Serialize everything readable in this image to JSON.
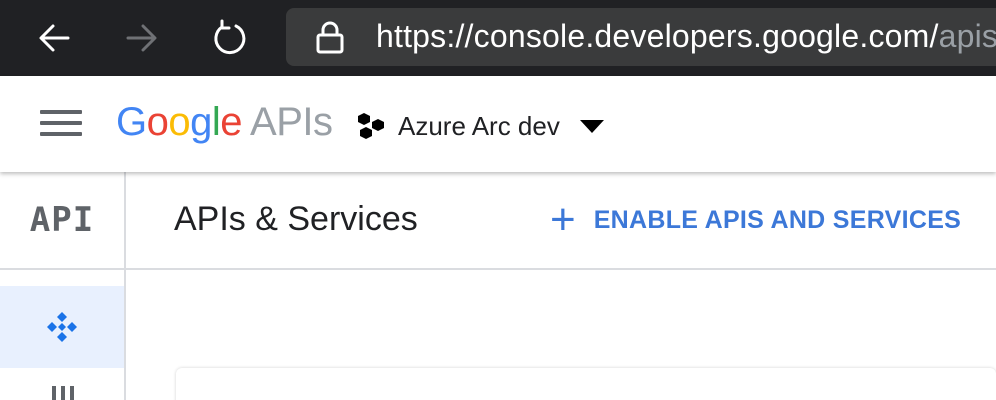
{
  "browser": {
    "url_main": "https://console.developers.google.com/",
    "url_path": "apis/",
    "icons": [
      "back-icon",
      "forward-icon",
      "reload-icon",
      "lock-icon"
    ]
  },
  "header": {
    "logo_letters": [
      "G",
      "o",
      "o",
      "g",
      "l",
      "e"
    ],
    "logo_suffix": "APIs",
    "project_name": "Azure Arc dev",
    "brand_colors": {
      "blue": "#4285f4",
      "red": "#ea4335",
      "yellow": "#fbbc05",
      "green": "#34a853"
    }
  },
  "rail": {
    "api_label": "API",
    "active_color": "#e8f0fe",
    "icons": [
      "dashboard-icon",
      "library-icon"
    ]
  },
  "main": {
    "title": "APIs & Services",
    "enable_label": "ENABLE APIS AND SERVICES",
    "accent_color": "#3c78d8"
  }
}
